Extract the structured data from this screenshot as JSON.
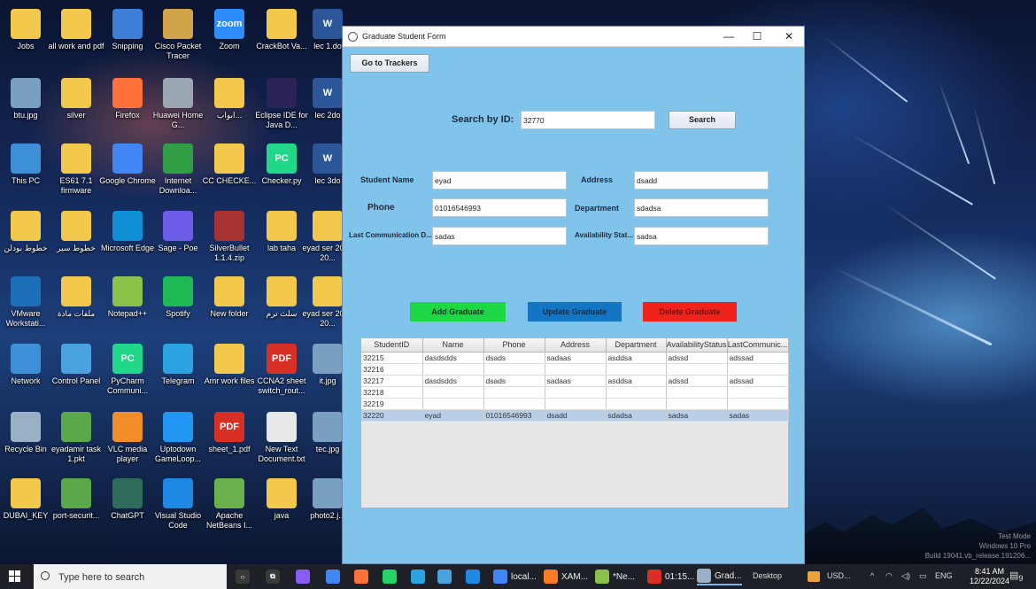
{
  "desktop_icons": [
    {
      "label": "Jobs",
      "color": "#f2c94c",
      "glyph": ""
    },
    {
      "label": "all work and pdf",
      "color": "#f2c94c",
      "glyph": ""
    },
    {
      "label": "Snipping",
      "color": "#3d7fd8",
      "glyph": ""
    },
    {
      "label": "Cisco Packet Tracer",
      "color": "#d1a34a",
      "glyph": ""
    },
    {
      "label": "Zoom",
      "color": "#2d8cff",
      "glyph": "zoom"
    },
    {
      "label": "CrackBot Va...",
      "color": "#f2c94c",
      "glyph": ""
    },
    {
      "label": "lec 1.do",
      "color": "#2b579a",
      "glyph": "W"
    },
    {
      "label": "btu.jpg",
      "color": "#7aa0c0",
      "glyph": ""
    },
    {
      "label": "silver",
      "color": "#f2c94c",
      "glyph": ""
    },
    {
      "label": "Firefox",
      "color": "#ff7139",
      "glyph": ""
    },
    {
      "label": "Huawei Home G...",
      "color": "#9aa6b2",
      "glyph": ""
    },
    {
      "label": "ابواب...",
      "color": "#f2c94c",
      "glyph": ""
    },
    {
      "label": "Eclipse IDE for Java D...",
      "color": "#2c2255",
      "glyph": ""
    },
    {
      "label": "lec 2do",
      "color": "#2b579a",
      "glyph": "W"
    },
    {
      "label": "This PC",
      "color": "#3d8fd8",
      "glyph": ""
    },
    {
      "label": "ES61 7.1 firmware",
      "color": "#f2c94c",
      "glyph": ""
    },
    {
      "label": "Google Chrome",
      "color": "#4285f4",
      "glyph": ""
    },
    {
      "label": "Internet Downloa...",
      "color": "#2f9e44",
      "glyph": ""
    },
    {
      "label": "CC CHECKE...",
      "color": "#f2c94c",
      "glyph": ""
    },
    {
      "label": "Checker.py",
      "color": "#21d789",
      "glyph": "PC"
    },
    {
      "label": "lec 3do",
      "color": "#2b579a",
      "glyph": "W"
    },
    {
      "label": "خطوط بودلن",
      "color": "#f2c94c",
      "glyph": ""
    },
    {
      "label": "خطوط سير",
      "color": "#f2c94c",
      "glyph": ""
    },
    {
      "label": "Microsoft Edge",
      "color": "#0f8fd6",
      "glyph": ""
    },
    {
      "label": "Sage - Poe",
      "color": "#6c5ce7",
      "glyph": ""
    },
    {
      "label": "SilverBullet 1.1.4.zip",
      "color": "#a83232",
      "glyph": ""
    },
    {
      "label": "lab taha",
      "color": "#f2c94c",
      "glyph": ""
    },
    {
      "label": "eyad ser 2012 20...",
      "color": "#f2c94c",
      "glyph": ""
    },
    {
      "label": "VMware Workstati...",
      "color": "#1d6fb8",
      "glyph": ""
    },
    {
      "label": "ملفات مادة",
      "color": "#f2c94c",
      "glyph": ""
    },
    {
      "label": "Notepad++",
      "color": "#8bc34a",
      "glyph": ""
    },
    {
      "label": "Spotify",
      "color": "#1db954",
      "glyph": ""
    },
    {
      "label": "New folder",
      "color": "#f2c94c",
      "glyph": ""
    },
    {
      "label": "سلث ترم",
      "color": "#f2c94c",
      "glyph": ""
    },
    {
      "label": "eyad ser 2012 20...",
      "color": "#f2c94c",
      "glyph": ""
    },
    {
      "label": "Network",
      "color": "#3d8fd8",
      "glyph": ""
    },
    {
      "label": "Control Panel",
      "color": "#4aa3df",
      "glyph": ""
    },
    {
      "label": "PyCharm Communi...",
      "color": "#21d789",
      "glyph": "PC"
    },
    {
      "label": "Telegram",
      "color": "#2aa3e0",
      "glyph": ""
    },
    {
      "label": "Amr work files",
      "color": "#f2c94c",
      "glyph": ""
    },
    {
      "label": "CCNA2 sheet switch_rout...",
      "color": "#d93025",
      "glyph": "PDF"
    },
    {
      "label": "it.jpg",
      "color": "#7aa0c0",
      "glyph": ""
    },
    {
      "label": "Recycle Bin",
      "color": "#9ab0c4",
      "glyph": ""
    },
    {
      "label": "eyadamir task 1.pkt",
      "color": "#5aa84a",
      "glyph": ""
    },
    {
      "label": "VLC media player",
      "color": "#f28c28",
      "glyph": ""
    },
    {
      "label": "Uptodown GameLoop...",
      "color": "#2196f3",
      "glyph": ""
    },
    {
      "label": "sheet_1.pdf",
      "color": "#d93025",
      "glyph": "PDF"
    },
    {
      "label": "New Text Document.txt",
      "color": "#e8e8e8",
      "glyph": ""
    },
    {
      "label": "tec.jpg",
      "color": "#7aa0c0",
      "glyph": ""
    },
    {
      "label": "DUBAI_KEY",
      "color": "#f2c94c",
      "glyph": ""
    },
    {
      "label": "port-securit...",
      "color": "#5aa84a",
      "glyph": ""
    },
    {
      "label": "ChatGPT",
      "color": "#2f6b5a",
      "glyph": ""
    },
    {
      "label": "Visual Studio Code",
      "color": "#1e88e5",
      "glyph": ""
    },
    {
      "label": "Apache NetBeans I...",
      "color": "#6ab04c",
      "glyph": ""
    },
    {
      "label": "java",
      "color": "#f2c94c",
      "glyph": ""
    },
    {
      "label": "photo2.j...",
      "color": "#7aa0c0",
      "glyph": ""
    }
  ],
  "window": {
    "title": "Graduate Student Form",
    "minimize_glyph": "—",
    "maximize_glyph": "☐",
    "close_glyph": "✕"
  },
  "form": {
    "go_to_trackers_label": "Go to Trackers",
    "search_label": "Search by ID:",
    "search_value": "32770",
    "search_button_label": "Search",
    "student_name_label": "Student Name",
    "student_name_value": "eyad",
    "address_label": "Address",
    "address_value": "dsadd",
    "phone_label": "Phone",
    "phone_value": "01016546993",
    "department_label": "Department",
    "department_value": "sdadsa",
    "last_comm_label": "Last Communication D...",
    "last_comm_value": "sadas",
    "availability_label": "Availability Stat...",
    "availability_value": "sadsa",
    "add_label": "Add Graduate",
    "update_label": "Update Graduate",
    "delete_label": "Delete Graduate",
    "add_color": "#1ed744",
    "update_color": "#1376c2",
    "delete_color": "#f0221c"
  },
  "table": {
    "columns": [
      "StudentID",
      "Name",
      "Phone",
      "Address",
      "Department",
      "AvailabilityStatus",
      "LastCommunic..."
    ],
    "rows": [
      [
        "32215",
        "dasdsdds",
        "dsads",
        "sadaas",
        "asddsa",
        "adssd",
        "adssad"
      ],
      [
        "32216",
        "",
        "",
        "",
        "",
        "",
        ""
      ],
      [
        "32217",
        "dasdsdds",
        "dsads",
        "sadaas",
        "asddsa",
        "adssd",
        "adssad"
      ],
      [
        "32218",
        "",
        "",
        "",
        "",
        "",
        ""
      ],
      [
        "32219",
        "",
        "",
        "",
        "",
        "",
        ""
      ],
      [
        "32220",
        "eyad",
        "01016546993",
        "dsadd",
        "sdadsa",
        "sadsa",
        "sadas"
      ]
    ],
    "selected_row_index": 5
  },
  "taskbar": {
    "search_placeholder": "Type here to search",
    "items": [
      {
        "label": "",
        "color": "#3a3a3a",
        "glyph": "○"
      },
      {
        "label": "",
        "color": "#3a3a3a",
        "glyph": "⧉"
      },
      {
        "label": "",
        "color": "#8a5cf6",
        "glyph": ""
      },
      {
        "label": "",
        "color": "#4285f4",
        "glyph": ""
      },
      {
        "label": "",
        "color": "#ff7139",
        "glyph": ""
      },
      {
        "label": "",
        "color": "#25d366",
        "glyph": ""
      },
      {
        "label": "",
        "color": "#2aa3e0",
        "glyph": ""
      },
      {
        "label": "",
        "color": "#4aa3df",
        "glyph": ""
      },
      {
        "label": "",
        "color": "#1e88e5",
        "glyph": ""
      },
      {
        "label": "local...",
        "color": "#4285f4",
        "glyph": ""
      },
      {
        "label": "XAM...",
        "color": "#fb7a24",
        "glyph": ""
      },
      {
        "label": "*Ne...",
        "color": "#8bc34a",
        "glyph": ""
      },
      {
        "label": "01:15...",
        "color": "#d93025",
        "glyph": ""
      },
      {
        "label": "Grad...",
        "color": "#9ab0c4",
        "glyph": ""
      }
    ],
    "desktop_label": "Desktop",
    "currency_label": "USD...",
    "language": "ENG",
    "time": "8:41 AM",
    "date": "12/22/2024",
    "notification_count": "9"
  },
  "watermark": {
    "line1": "Test Mode",
    "line2": "Windows 10 Pro",
    "line3": "Build 19041.vb_release.191206..."
  }
}
